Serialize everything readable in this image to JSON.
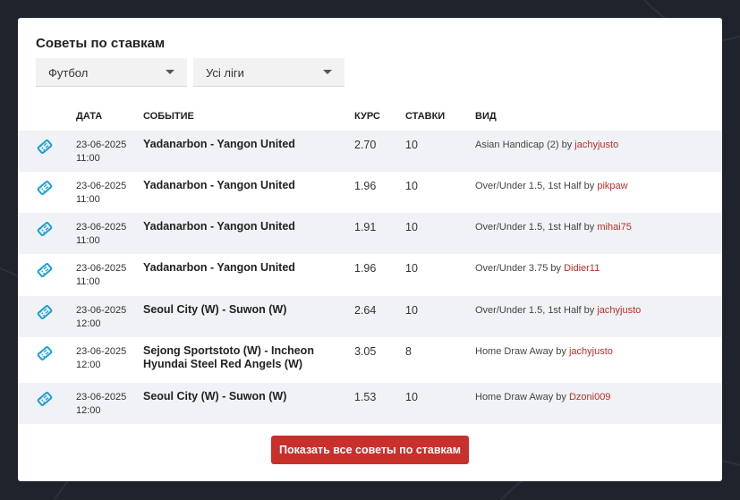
{
  "widget": {
    "title": "Советы по ставкам"
  },
  "filters": {
    "sport": "Футбол",
    "league": "Усі ліги"
  },
  "columns": {
    "date": "ДАТА",
    "event": "СОБЫТИЕ",
    "odds": "КУРС",
    "bets": "СТАВКИ",
    "kind": "ВИД"
  },
  "rows": [
    {
      "date": "23-06-2025",
      "time": "11:00",
      "event": "Yadanarbon - Yangon United",
      "odds": "2.70",
      "bets": "10",
      "tip": "Asian Handicap (2) by",
      "user": "jachyjusto"
    },
    {
      "date": "23-06-2025",
      "time": "11:00",
      "event": "Yadanarbon - Yangon United",
      "odds": "1.96",
      "bets": "10",
      "tip": "Over/Under 1.5, 1st Half by",
      "user": "pikpaw"
    },
    {
      "date": "23-06-2025",
      "time": "11:00",
      "event": "Yadanarbon - Yangon United",
      "odds": "1.91",
      "bets": "10",
      "tip": "Over/Under 1.5, 1st Half by",
      "user": "mihai75"
    },
    {
      "date": "23-06-2025",
      "time": "11:00",
      "event": "Yadanarbon - Yangon United",
      "odds": "1.96",
      "bets": "10",
      "tip": "Over/Under 3.75 by",
      "user": "Didier11"
    },
    {
      "date": "23-06-2025",
      "time": "12:00",
      "event": "Seoul City (W) - Suwon (W)",
      "odds": "2.64",
      "bets": "10",
      "tip": "Over/Under 1.5, 1st Half by",
      "user": "jachyjusto"
    },
    {
      "date": "23-06-2025",
      "time": "12:00",
      "event": "Sejong Sportstoto (W) - Incheon Hyundai Steel Red Angels (W)",
      "odds": "3.05",
      "bets": "8",
      "tip": "Home Draw Away by",
      "user": "jachyjusto"
    },
    {
      "date": "23-06-2025",
      "time": "12:00",
      "event": "Seoul City (W) - Suwon (W)",
      "odds": "1.53",
      "bets": "10",
      "tip": "Home Draw Away by",
      "user": "Dzoni009"
    }
  ],
  "actions": {
    "show_all": "Показать все советы по ставкам"
  },
  "icons": {
    "row": "ticket-icon"
  },
  "colors": {
    "accent": "#c9302c",
    "icon": "#1a9fd8",
    "link": "#b5302a"
  }
}
